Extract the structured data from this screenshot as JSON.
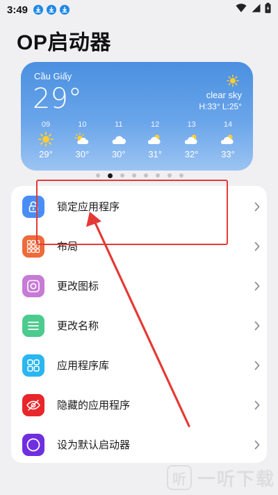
{
  "status_bar": {
    "time": "3:49"
  },
  "header": {
    "title": "OP启动器"
  },
  "weather": {
    "city": "Cầu Giấy",
    "temperature": "29°",
    "condition": "clear sky",
    "high_low": "H:33° L:25°",
    "forecast": [
      {
        "hour": "09",
        "icon": "sun-icon",
        "temp": "29°"
      },
      {
        "hour": "10",
        "icon": "sun-cloud-icon",
        "temp": "30°"
      },
      {
        "hour": "11",
        "icon": "cloud-icon",
        "temp": "30°"
      },
      {
        "hour": "12",
        "icon": "cloud-sun-icon",
        "temp": "31°"
      },
      {
        "hour": "13",
        "icon": "cloud-sun-icon",
        "temp": "32°"
      },
      {
        "hour": "14",
        "icon": "cloud-sun-icon",
        "temp": "33°"
      }
    ]
  },
  "pager": {
    "count": 8,
    "active": 1
  },
  "menu": {
    "items": [
      {
        "label": "锁定应用程序",
        "icon": "lock-icon",
        "color": "#4a8ef5"
      },
      {
        "label": "布局",
        "icon": "grid-layout-icon",
        "color": "#ef6a3a"
      },
      {
        "label": "更改图标",
        "icon": "image-icon",
        "color": "#c77ad6"
      },
      {
        "label": "更改名称",
        "icon": "text-lines-icon",
        "color": "#4dcb8f"
      },
      {
        "label": "应用程序库",
        "icon": "app-library-icon",
        "color": "#2ab6ef"
      },
      {
        "label": "隐藏的应用程序",
        "icon": "eye-hidden-icon",
        "color": "#e8262b"
      },
      {
        "label": "设为默认启动器",
        "icon": "circle-icon",
        "color": "#6f2fe0"
      }
    ]
  },
  "annotation": {
    "color": "#e53935"
  },
  "watermark": {
    "logo": "听",
    "text": "一听下载"
  }
}
